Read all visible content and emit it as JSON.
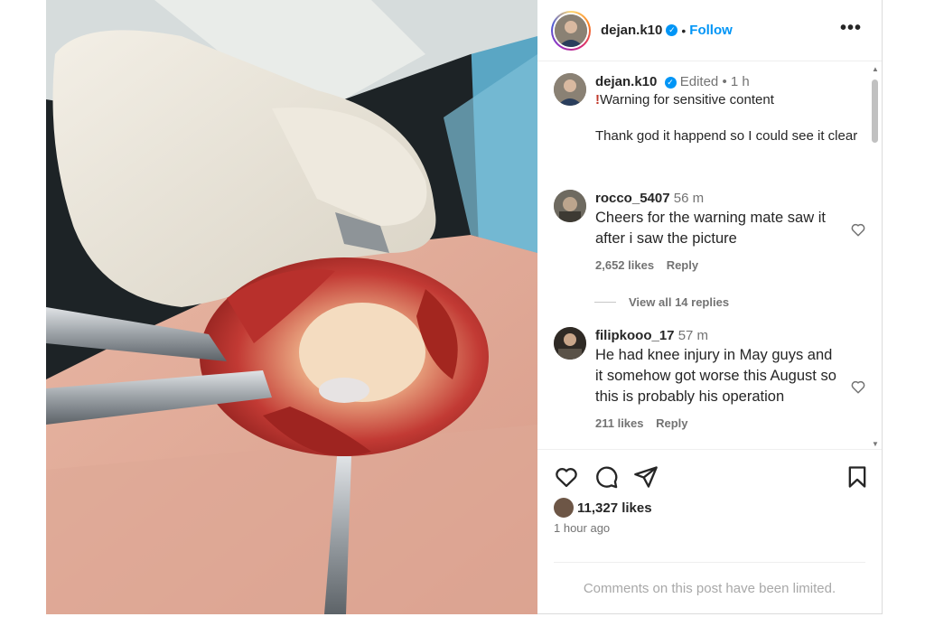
{
  "header": {
    "username": "dejan.k10",
    "separator": "•",
    "follow_label": "Follow",
    "more_label": "•••"
  },
  "caption": {
    "username": "dejan.k10",
    "edited": "Edited",
    "separator": "•",
    "time": "1 h",
    "warning_mark": "!",
    "line1": "Warning for sensitive content",
    "line2": "Thank god it happend so I could see it clear"
  },
  "comments": [
    {
      "username": "rocco_5407",
      "time": "56 m",
      "text": "Cheers for the warning mate saw it after i saw the picture",
      "likes": "2,652 likes",
      "reply_label": "Reply",
      "view_replies": "View all 14 replies"
    },
    {
      "username": "filipkooo_17",
      "time": "57 m",
      "text": "He had knee injury in May guys and it somehow got worse this August so this is probably his operation",
      "likes": "211 likes",
      "reply_label": "Reply"
    }
  ],
  "actions": {
    "icons": [
      "heart-icon",
      "comment-icon",
      "share-icon",
      "bookmark-icon"
    ]
  },
  "likes_count": "11,327 likes",
  "time_ago": "1 hour ago",
  "limited_notice": "Comments on this post have been limited.",
  "colors": {
    "link": "#0095f6",
    "muted": "#737373",
    "border": "#dbdbdb"
  }
}
